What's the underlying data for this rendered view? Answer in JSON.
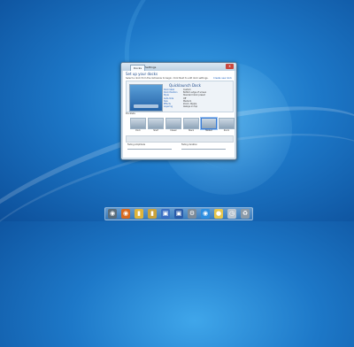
{
  "dialog": {
    "tabs": [
      "Docks",
      "Settings"
    ],
    "close_label": "x",
    "heading": "Set up your docks",
    "subtext": "Select a dock from the list below to begin. Click Next to edit dock settings.",
    "link": "Create new dock",
    "dock_name": "Quicklaunch Dock",
    "properties": [
      {
        "key": "Dock label",
        "value": "Custom"
      },
      {
        "key": "Dock Position",
        "value": "Bottom edge of screen"
      },
      {
        "key": "Style",
        "value": "Standard dock preset"
      },
      {
        "key": "Auto-hide",
        "value": "Off"
      },
      {
        "key": "Size",
        "value": "Medium"
      },
      {
        "key": "Effects",
        "value": "Zoom, Ripple"
      },
      {
        "key": "Layering",
        "value": "Always on top"
      }
    ],
    "section_title": "Docklets",
    "thumbnails": [
      "Dock",
      "Shelf",
      "Classic",
      "Stack",
      "Tabbed",
      "Zoom"
    ],
    "field1_label": "Fading Amplitude",
    "field2_label": "Fading duration"
  },
  "dock": {
    "icons": [
      {
        "name": "finder-icon",
        "color": "#5a6c7a"
      },
      {
        "name": "firefox-icon",
        "color": "#d86a1f"
      },
      {
        "name": "folder-icon",
        "color": "#e0b43a"
      },
      {
        "name": "folder-icon",
        "color": "#c9a23c"
      },
      {
        "name": "photos-icon",
        "color": "#3b6fc4"
      },
      {
        "name": "word-icon",
        "color": "#2a5caa"
      },
      {
        "name": "gear-icon",
        "color": "#7c8b99"
      },
      {
        "name": "ie-icon",
        "color": "#2d8ee0"
      },
      {
        "name": "notes-icon",
        "color": "#e7c54c"
      },
      {
        "name": "clock-icon",
        "color": "#b9c4cf"
      },
      {
        "name": "trash-icon",
        "color": "#8b9aa8"
      }
    ]
  }
}
